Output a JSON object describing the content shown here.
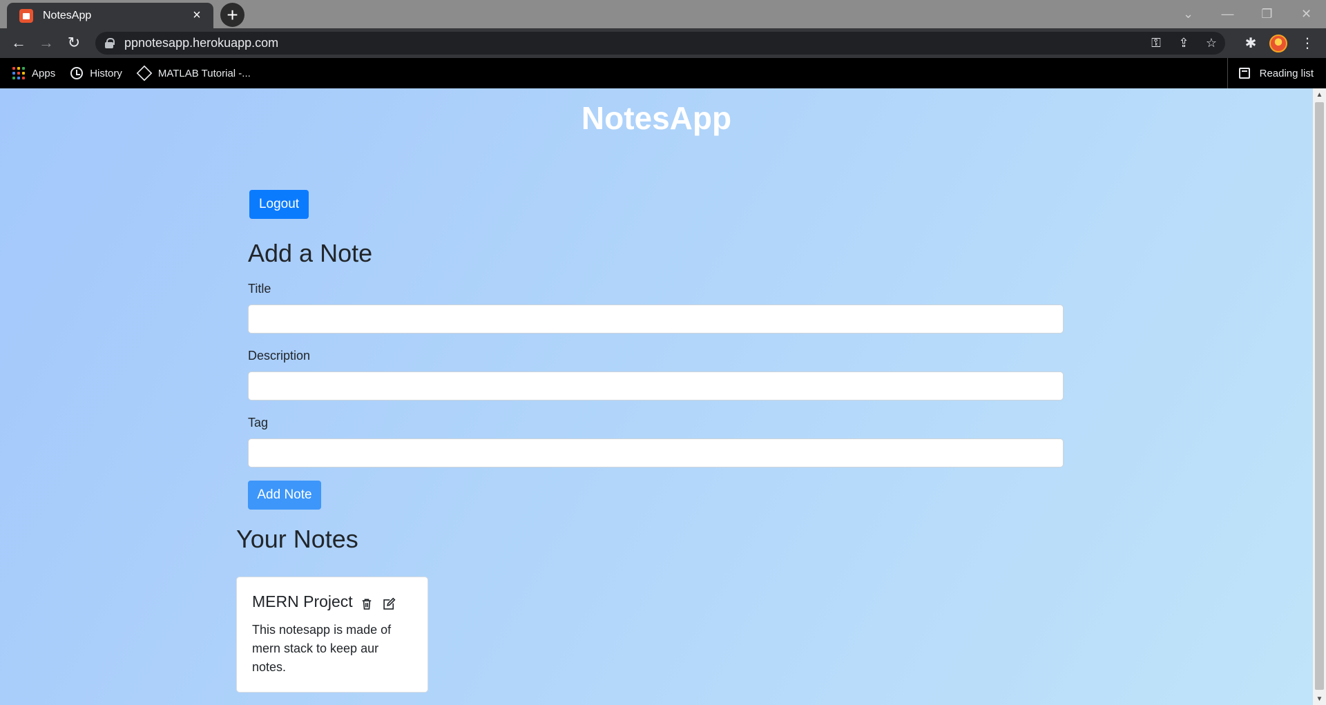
{
  "browser": {
    "tab_title": "NotesApp",
    "url": "ppnotesapp.herokuapp.com",
    "bookmarks": [
      {
        "label": "Apps",
        "icon": "apps-grid-icon"
      },
      {
        "label": "History",
        "icon": "history-icon"
      },
      {
        "label": "MATLAB Tutorial -...",
        "icon": "matlab-icon"
      }
    ],
    "reading_list": "Reading list"
  },
  "page": {
    "app_title": "NotesApp",
    "logout_label": "Logout",
    "add_heading": "Add a Note",
    "form": {
      "title_label": "Title",
      "description_label": "Description",
      "tag_label": "Tag",
      "title_value": "",
      "description_value": "",
      "tag_value": ""
    },
    "add_note_label": "Add Note",
    "your_notes_heading": "Your Notes",
    "notes": [
      {
        "title": "MERN Project",
        "description": "This notesapp is made of mern stack to keep aur notes."
      }
    ]
  },
  "colors": {
    "primary_button": "#0b7bfe",
    "add_note_button": "#3d96fa",
    "background_start": "#a3c8fb",
    "background_end": "#c0e4f9"
  }
}
